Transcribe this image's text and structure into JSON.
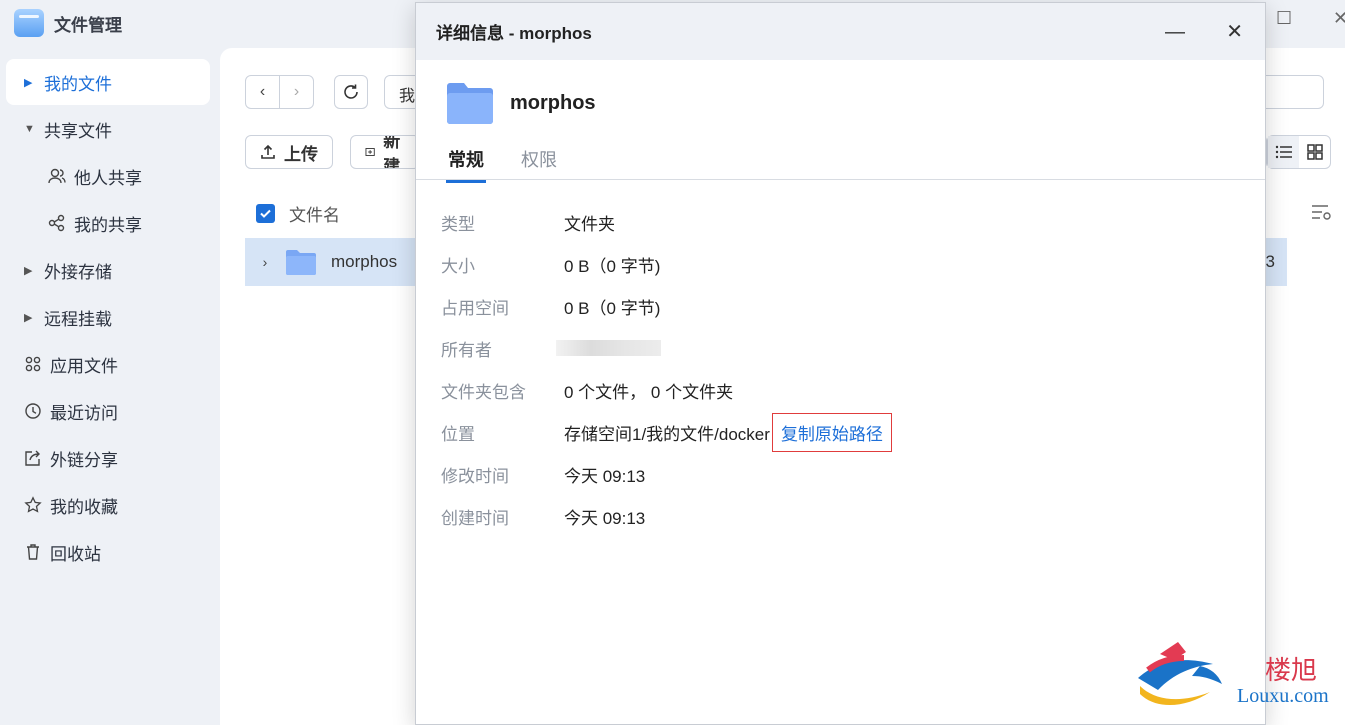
{
  "app": {
    "title": "文件管理"
  },
  "sidebar": {
    "items": [
      {
        "label": "我的文件",
        "icon": "caret-right-icon",
        "active": true
      },
      {
        "label": "共享文件",
        "icon": "caret-down-icon"
      },
      {
        "label": "他人共享",
        "icon": "people-icon"
      },
      {
        "label": "我的共享",
        "icon": "share-icon"
      },
      {
        "label": "外接存储",
        "icon": "caret-right-icon"
      },
      {
        "label": "远程挂载",
        "icon": "caret-right-icon"
      },
      {
        "label": "应用文件",
        "icon": "apps-icon"
      },
      {
        "label": "最近访问",
        "icon": "clock-icon"
      },
      {
        "label": "外链分享",
        "icon": "external-share-icon"
      },
      {
        "label": "我的收藏",
        "icon": "star-icon"
      },
      {
        "label": "回收站",
        "icon": "trash-icon"
      }
    ]
  },
  "toolbar": {
    "path_text": "我",
    "upload_label": "上传",
    "new_label": "新建"
  },
  "list": {
    "header_name": "文件名",
    "rows": [
      {
        "name": "morphos",
        "trailing": "3"
      }
    ]
  },
  "dialog": {
    "title": "详细信息 - morphos",
    "folder_name": "morphos",
    "tabs": {
      "general": "常规",
      "permissions": "权限"
    },
    "props": {
      "type": {
        "k": "类型",
        "v": "文件夹"
      },
      "size": {
        "k": "大小",
        "v": "0 B（0 字节)"
      },
      "used": {
        "k": "占用空间",
        "v": "0 B（0 字节)"
      },
      "owner": {
        "k": "所有者",
        "v": ""
      },
      "contains": {
        "k": "文件夹包含",
        "v": "0 个文件， 0 个文件夹"
      },
      "location": {
        "k": "位置",
        "v": "存储空间1/我的文件/docker",
        "copy": "复制原始路径"
      },
      "modified": {
        "k": "修改时间",
        "v": "今天 09:13"
      },
      "created": {
        "k": "创建时间",
        "v": "今天 09:13"
      }
    }
  },
  "watermark": {
    "cn": "楼旭",
    "en": "Louxu.com"
  },
  "colors": {
    "accent": "#1d6fd8",
    "selected_row": "#d6e4f6",
    "highlight_border": "#e03c3c"
  }
}
